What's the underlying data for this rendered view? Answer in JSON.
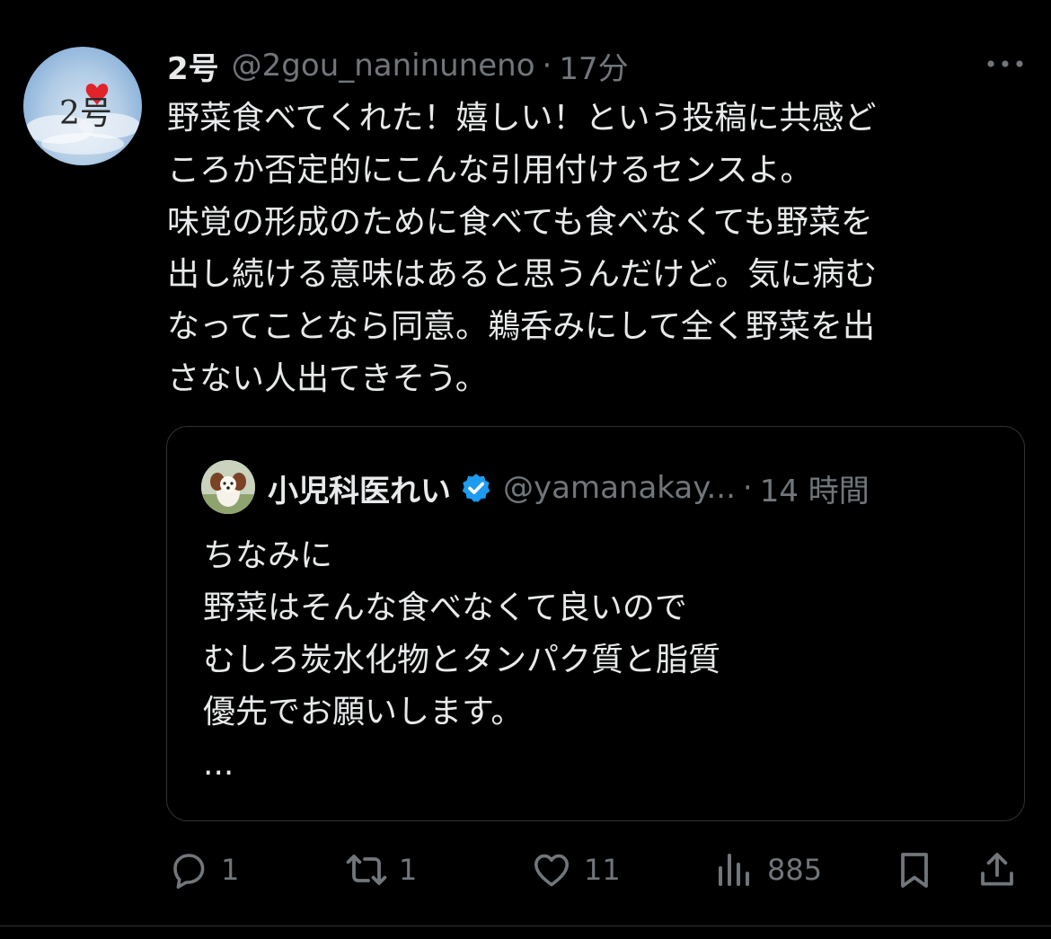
{
  "tweet": {
    "display_name": "2号",
    "handle": "@2gou_naninuneno",
    "separator": "·",
    "time": "17分",
    "avatar_text": "2号",
    "body_lines": [
      "野菜食べてくれた！嬉しい！という投稿に共感ど",
      "ころか否定的にこんな引用付けるセンスよ。",
      "味覚の形成のために食べても食べなくても野菜を",
      "出し続ける意味はあると思うんだけど。気に病む",
      "なってことなら同意。鵜呑みにして全く野菜を出",
      "さない人出てきそう。"
    ]
  },
  "quote": {
    "display_name": "小児科医れい",
    "verified": true,
    "handle": "@yamanakay...",
    "separator": "·",
    "time": "14 時間",
    "body_lines": [
      "ちなみに",
      "野菜はそんな食べなくて良いので",
      "むしろ炭水化物とタンパク質と脂質",
      "優先でお願いします。",
      "..."
    ]
  },
  "actions": {
    "reply_count": "1",
    "retweet_count": "1",
    "like_count": "11",
    "views_count": "885"
  },
  "icons": {
    "more": "more-horizontal-icon",
    "verified": "verified-badge-icon",
    "reply": "reply-icon",
    "retweet": "retweet-icon",
    "like": "heart-icon",
    "views": "views-chart-icon",
    "bookmark": "bookmark-icon",
    "share": "share-icon"
  },
  "colors": {
    "background": "#000000",
    "text_primary": "#e7e9ea",
    "text_secondary": "#71767b",
    "border": "#2f3336",
    "verified_blue": "#1d9bf0"
  }
}
